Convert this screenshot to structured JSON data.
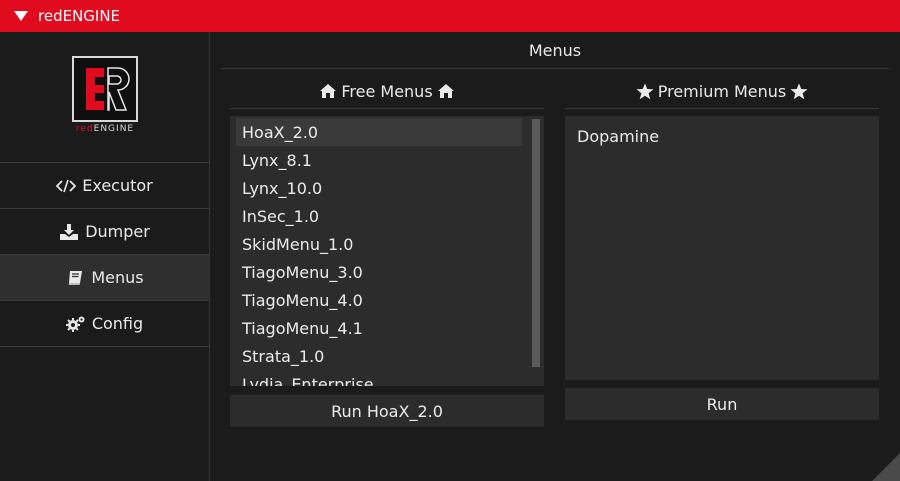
{
  "window": {
    "title": "redENGINE"
  },
  "logo": {
    "tagline_red": "red",
    "tagline_rest": "ENGINE"
  },
  "sidebar": {
    "items": [
      {
        "label": "Executor",
        "icon": "code-icon"
      },
      {
        "label": "Dumper",
        "icon": "download-icon"
      },
      {
        "label": "Menus",
        "icon": "book-icon",
        "active": true
      },
      {
        "label": "Config",
        "icon": "gears-icon"
      }
    ]
  },
  "main": {
    "header": "Menus",
    "free": {
      "title": "Free Menus",
      "icon": "home-icon",
      "items": [
        "HoaX_2.0",
        "Lynx_8.1",
        "Lynx_10.0",
        "InSec_1.0",
        "SkidMenu_1.0",
        "TiagoMenu_3.0",
        "TiagoMenu_4.0",
        "TiagoMenu_4.1",
        "Strata_1.0",
        "Lydia_Enterprise"
      ],
      "selected_index": 0,
      "run_label": "Run HoaX_2.0"
    },
    "premium": {
      "title": "Premium Menus",
      "icon": "star-icon",
      "items": [
        "Dopamine"
      ],
      "run_label": "Run"
    }
  },
  "colors": {
    "accent": "#e10b20",
    "background": "#1b1b1b",
    "panel": "#2c2c2c",
    "selected": "#3a3a3a"
  }
}
